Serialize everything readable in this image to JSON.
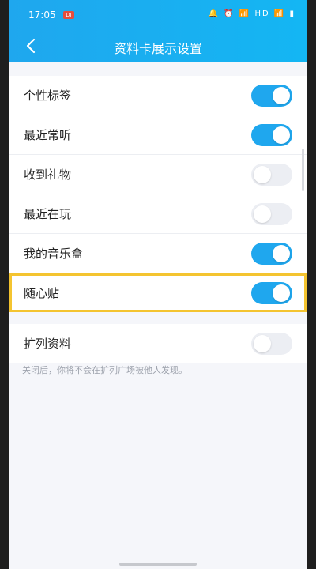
{
  "status_bar": {
    "time": "17:05",
    "badge": "DI",
    "indicators": "🔔 ⏰ 📶 HD 📶 ▮"
  },
  "header": {
    "title": "资料卡展示设置",
    "back_icon": "chevron-left-icon"
  },
  "settings": [
    {
      "label": "个性标签",
      "on": true
    },
    {
      "label": "最近常听",
      "on": true
    },
    {
      "label": "收到礼物",
      "on": false
    },
    {
      "label": "最近在玩",
      "on": false
    },
    {
      "label": "我的音乐盒",
      "on": true
    },
    {
      "label": "随心贴",
      "on": true,
      "highlighted": true
    }
  ],
  "extended": {
    "label": "扩列资料",
    "on": false,
    "note": "关闭后，你将不会在扩列广场被他人发现。"
  },
  "colors": {
    "accent": "#1fa7ee",
    "highlight": "#f4c430"
  }
}
